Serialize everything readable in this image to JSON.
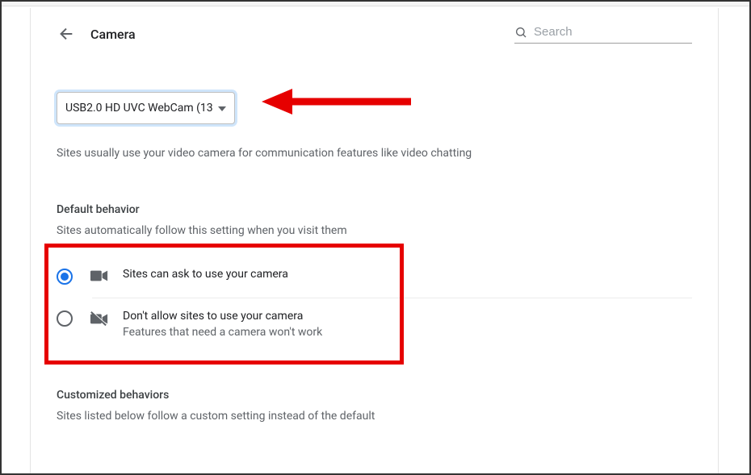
{
  "header": {
    "title": "Camera"
  },
  "search": {
    "placeholder": "Search"
  },
  "device_select": {
    "value": "USB2.0 HD UVC WebCam (13"
  },
  "description": "Sites usually use your video camera for communication features like video chatting",
  "default_behavior": {
    "title": "Default behavior",
    "sub": "Sites automatically follow this setting when you visit them",
    "options": {
      "ask": {
        "label": "Sites can ask to use your camera"
      },
      "block": {
        "label": "Don't allow sites to use your camera",
        "sub": "Features that need a camera won't work"
      }
    }
  },
  "customized": {
    "title": "Customized behaviors",
    "sub": "Sites listed below follow a custom setting instead of the default"
  }
}
